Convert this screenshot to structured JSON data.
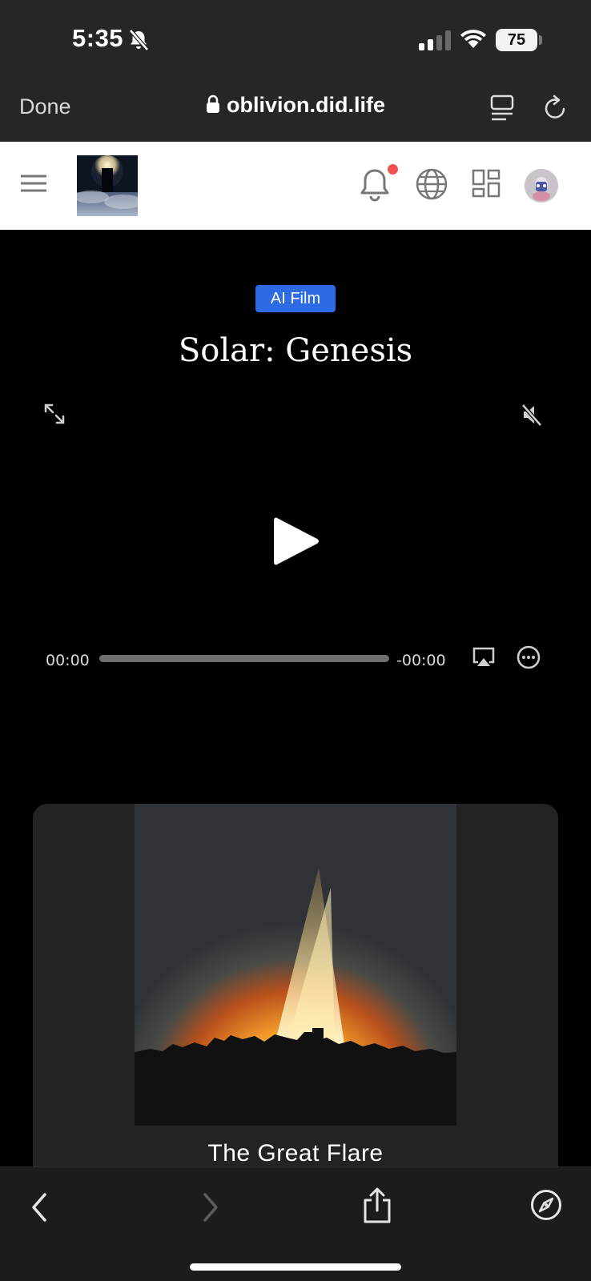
{
  "status_bar": {
    "time": "5:35",
    "battery": "75",
    "signal_bars_active": 2,
    "icons": [
      "bell-slash-icon",
      "signal-icon",
      "wifi-icon",
      "battery-icon"
    ]
  },
  "browser": {
    "done_label": "Done",
    "url": "oblivion.did.life",
    "icons": [
      "lock-icon",
      "reader-icon",
      "reload-icon"
    ]
  },
  "site_header": {
    "icons": [
      "menu-icon",
      "site-logo",
      "notification-bell-icon",
      "globe-icon",
      "grid-icon",
      "avatar"
    ],
    "notification_dot_color": "#ef5350"
  },
  "video": {
    "badge": "AI Film",
    "badge_color": "#2c6be3",
    "title": "Solar: Genesis",
    "current_time": "00:00",
    "remaining_time": "-00:00",
    "progress": 0,
    "icons": [
      "expand-icon",
      "mute-icon",
      "play-icon",
      "airplay-icon",
      "more-icon"
    ]
  },
  "card": {
    "title": "The Great Flare"
  },
  "bottom_bar": {
    "icons": [
      "back-icon",
      "forward-icon",
      "share-icon",
      "compass-icon"
    ]
  }
}
